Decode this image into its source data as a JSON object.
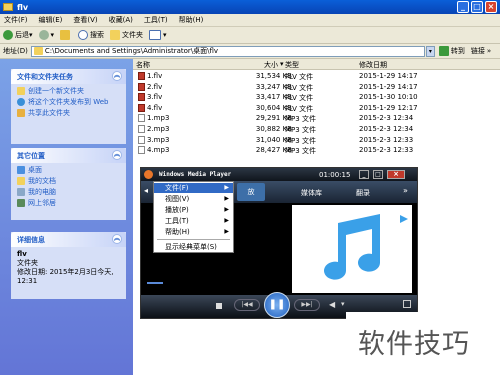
{
  "window": {
    "title": "flv"
  },
  "menubar": [
    "文件(F)",
    "编辑(E)",
    "查看(V)",
    "收藏(A)",
    "工具(T)",
    "帮助(H)"
  ],
  "toolbar": {
    "back": "后退",
    "search": "搜索",
    "folders": "文件夹"
  },
  "address": {
    "label": "地址(D)",
    "path": "C:\\Documents and Settings\\Administrator\\桌面\\flv",
    "go": "转到",
    "links": "链接"
  },
  "tasks": {
    "title": "文件和文件夹任务",
    "items": [
      "创建一个新文件夹",
      "将这个文件夹发布到 Web",
      "共享此文件夹"
    ]
  },
  "places": {
    "title": "其它位置",
    "items": [
      "桌面",
      "我的文档",
      "我的电脑",
      "网上邻居"
    ]
  },
  "details": {
    "title": "详细信息",
    "name": "flv",
    "type": "文件夹",
    "modified": "修改日期: 2015年2月3日今天, 12:31"
  },
  "columns": {
    "name": "名称",
    "size": "大小",
    "type": "类型",
    "modified": "修改日期"
  },
  "files": [
    {
      "name": "1.flv",
      "size": "31,534 KB",
      "type": "FLV 文件",
      "modified": "2015-1-29 14:17"
    },
    {
      "name": "2.flv",
      "size": "33,247 KB",
      "type": "FLV 文件",
      "modified": "2015-1-29 14:17"
    },
    {
      "name": "3.flv",
      "size": "33,417 KB",
      "type": "FLV 文件",
      "modified": "2015-1-30 10:10"
    },
    {
      "name": "4.flv",
      "size": "30,604 KB",
      "type": "FLV 文件",
      "modified": "2015-1-29 12:17"
    },
    {
      "name": "1.mp3",
      "size": "29,291 KB",
      "type": "MP3 文件",
      "modified": "2015-2-3 12:34"
    },
    {
      "name": "2.mp3",
      "size": "30,882 KB",
      "type": "MP3 文件",
      "modified": "2015-2-3 12:34"
    },
    {
      "name": "3.mp3",
      "size": "31,040 KB",
      "type": "MP3 文件",
      "modified": "2015-2-3 12:33"
    },
    {
      "name": "4.mp3",
      "size": "28,427 KB",
      "type": "MP3 文件",
      "modified": "2015-2-3 12:33"
    }
  ],
  "wmp": {
    "title": "Windows Media Player",
    "time": "01:00:15",
    "tabs": [
      "放",
      "媒体库",
      "翻录"
    ],
    "progress": 0.05
  },
  "context_menu": [
    "文件(F)",
    "视图(V)",
    "播放(P)",
    "工具(T)",
    "帮助(H)",
    "显示经典菜单(S)"
  ],
  "watermark": "软件技巧",
  "colors": {
    "xp_blue": "#0a5fd8",
    "taskpane": "#d6dff7",
    "link": "#215dc6",
    "music_note": "#3aa0e8",
    "menu_highlight": "#316ac5"
  }
}
